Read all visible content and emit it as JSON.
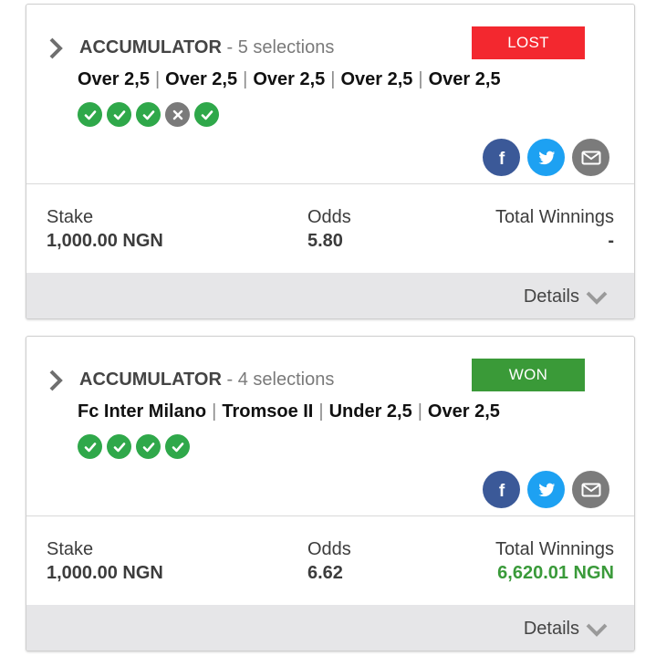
{
  "bets": [
    {
      "type": "ACCUMULATOR",
      "separator": "-",
      "selections_text": "5 selections",
      "status": "LOST",
      "status_color": "#f3282f",
      "picks": [
        "Over 2,5",
        "Over 2,5",
        "Over 2,5",
        "Over 2,5",
        "Over 2,5"
      ],
      "results": [
        "won",
        "won",
        "won",
        "lost",
        "won"
      ],
      "stake_label": "Stake",
      "stake_value": "1,000.00 NGN",
      "odds_label": "Odds",
      "odds_value": "5.80",
      "winnings_label": "Total Winnings",
      "winnings_value": "-",
      "details_label": "Details"
    },
    {
      "type": "ACCUMULATOR",
      "separator": "-",
      "selections_text": "4 selections",
      "status": "WON",
      "status_color": "#3a9a38",
      "picks": [
        "Fc Inter Milano",
        "Tromsoe II",
        "Under 2,5",
        "Over 2,5"
      ],
      "results": [
        "won",
        "won",
        "won",
        "won"
      ],
      "stake_label": "Stake",
      "stake_value": "1,000.00 NGN",
      "odds_label": "Odds",
      "odds_value": "6.62",
      "winnings_label": "Total Winnings",
      "winnings_value": "6,620.01 NGN",
      "details_label": "Details"
    }
  ],
  "icons": {
    "expand": "chevron-right-icon",
    "facebook": "facebook-icon",
    "twitter": "twitter-icon",
    "email": "email-icon",
    "details": "chevron-down-icon",
    "won": "check-icon",
    "lost": "x-icon"
  },
  "colors": {
    "won_green": "#2fa84a",
    "lost_grey": "#7a7a7a",
    "facebook": "#3b5998",
    "twitter": "#1da1f2",
    "email": "#7b7b7b",
    "winnings_green": "#3a9a3a"
  }
}
